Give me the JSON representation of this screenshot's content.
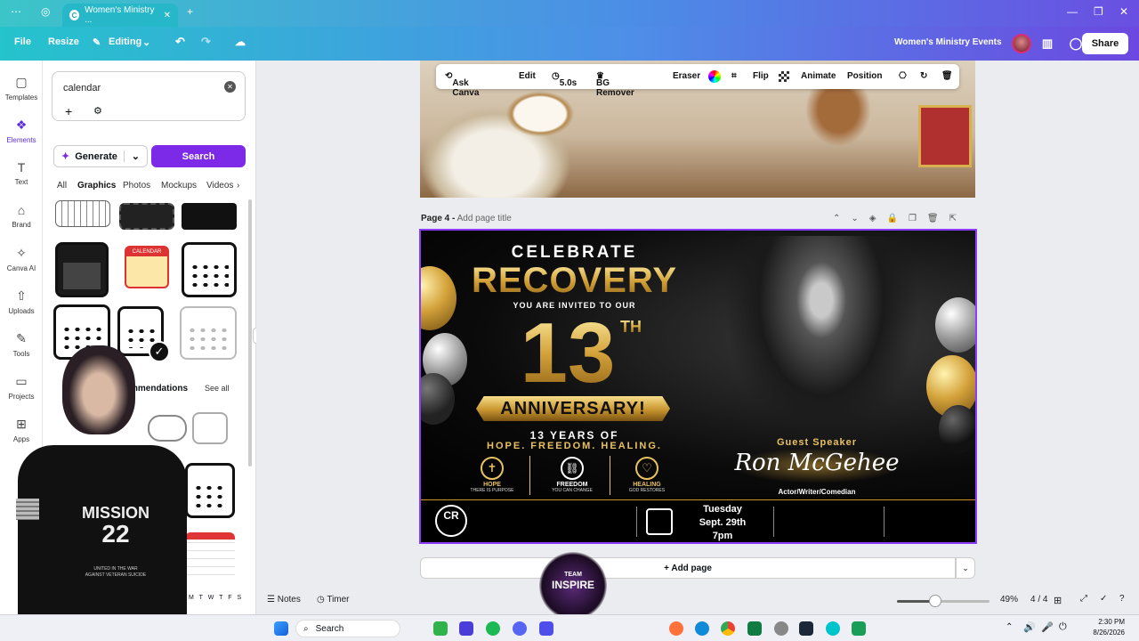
{
  "browser": {
    "tab_title": "Women's Ministry ...",
    "new_tab": "+",
    "minimize": "—",
    "restore": "❐",
    "close": "✕"
  },
  "topbar": {
    "file": "File",
    "resize": "Resize",
    "editing": "Editing",
    "project_title": "Women's Ministry Events",
    "share": "Share"
  },
  "rail": [
    {
      "label": "Templates",
      "icon": "▢"
    },
    {
      "label": "Elements",
      "icon": "❖"
    },
    {
      "label": "Text",
      "icon": "T"
    },
    {
      "label": "Brand",
      "icon": "⌂"
    },
    {
      "label": "Canva AI",
      "icon": "✧"
    },
    {
      "label": "Uploads",
      "icon": "⇧"
    },
    {
      "label": "Tools",
      "icon": "✎"
    },
    {
      "label": "Projects",
      "icon": "▭"
    },
    {
      "label": "Apps",
      "icon": "⊞"
    }
  ],
  "panel": {
    "search_value": "calendar",
    "generate": "Generate",
    "search": "Search",
    "filter_tabs": [
      "All",
      "Graphics",
      "Photos",
      "Mockups",
      "Videos"
    ],
    "recommendations_label": "mmendations",
    "see_all": "See all",
    "calendar_thumb_text": "CALENDAR",
    "weekday_strip": "M T W T F S"
  },
  "context_toolbar": {
    "ask_canva": "Ask Canva",
    "edit": "Edit",
    "duration": "5.0s",
    "bg_remover": "BG Remover",
    "eraser": "Eraser",
    "flip": "Flip",
    "animate": "Animate",
    "position": "Position"
  },
  "page_label": {
    "name": "Page 4 -",
    "placeholder": "Add page title"
  },
  "flyer": {
    "celebrate": "CELEBRATE",
    "recovery": "RECOVERY",
    "invited": "YOU ARE INVITED TO OUR",
    "number": "13",
    "th": "TH",
    "anniversary": "ANNIVERSARY!",
    "years": "13 YEARS OF",
    "tagline": "HOPE. FREEDOM. HEALING.",
    "pillars": [
      {
        "title": "HOPE",
        "sub": "THERE IS PURPOSE",
        "icon": "✝"
      },
      {
        "title": "FREEDOM",
        "sub": "YOU CAN CHANGE",
        "icon": "⛓"
      },
      {
        "title": "HEALING",
        "sub": "GOD RESTORES",
        "icon": "♡"
      }
    ],
    "guest_label": "Guest Speaker",
    "guest_name": "Ron McGehee",
    "guest_role": "Actor/Writer/Comedian",
    "logo_letters": "CR",
    "event_day": "Tuesday",
    "event_date": "Sept. 29th",
    "event_time": "7pm"
  },
  "add_page": "+ Add page",
  "footer": {
    "notes": "Notes",
    "timer": "Timer",
    "zoom": "49%",
    "pages": "4 / 4",
    "zoom_level": 0.49
  },
  "overlay": {
    "shirt_line1": "MISSION",
    "shirt_line2": "22",
    "shirt_line3": "UNITED IN THE WAR",
    "shirt_line4": "AGAINST VETERAN SUICIDE",
    "badge_line1": "TEAM",
    "badge_line2": "INSPIRE"
  },
  "taskbar": {
    "search": "Search",
    "time": "2:30 PM",
    "date": "8/26/2026"
  },
  "colors": {
    "accent_purple": "#7d2ae8",
    "gold": "#d4a23a",
    "selection": "#8b3dff"
  }
}
